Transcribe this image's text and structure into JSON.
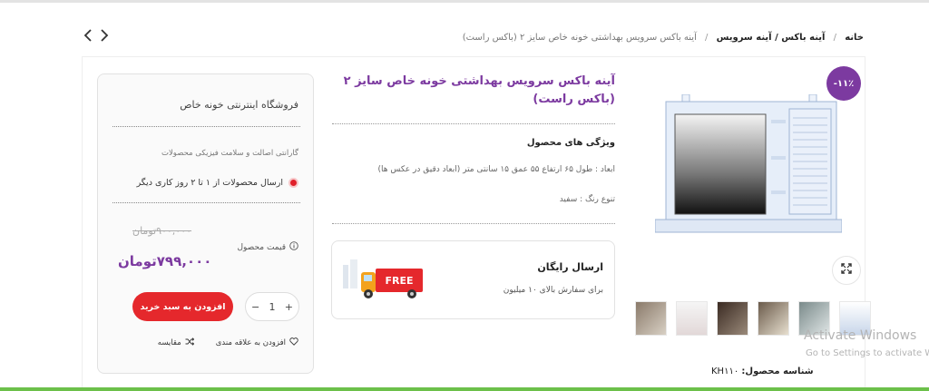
{
  "breadcrumb": {
    "home": "خانه",
    "category": "آینه باکس / آینه سرویس",
    "current": "آینه باکس سرویس بهداشتی خونه خاص سایز ۲ (باکس راست)",
    "separator": "/"
  },
  "nav": {
    "prev_icon": "chevron-left-icon",
    "next_icon": "chevron-right-icon"
  },
  "gallery": {
    "discount_badge": "-۱۱٪",
    "zoom_icon": "expand-icon",
    "thumbnail_count": 6,
    "sku_label": "شناسه محصول:",
    "sku_value": "KH۱۱۰"
  },
  "product": {
    "title": "آینه باکس سرویس بهداشتی خونه خاص سایز ۲ (باکس راست)",
    "features_heading": "ویژگی های محصول",
    "dimensions": "ابعاد : طول ۶۵ ارتفاع ۵۵ عمق ۱۵ سانتی متر (ابعاد دقیق در عکس ها)",
    "color_variety": "تنوع رنگ : سفید"
  },
  "shipping": {
    "title": "ارسال رایگان",
    "subtitle": "برای سفارش بالای ۱۰ میلیون",
    "truck_label": "FREE"
  },
  "buybox": {
    "shop_name": "فروشگاه اینترنتی خونه خاص",
    "guarantee": "گارانتی اصالت و سلامت فیزیکی محصولات",
    "delivery": "ارسال محصولات از ۱ تا ۲ روز کاری دیگر",
    "old_price": "۹۰۰,۰۰۰تومان",
    "price_label": "قیمت محصول",
    "price": "۷۹۹,۰۰۰تومان",
    "quantity": "1",
    "minus": "−",
    "plus": "+",
    "add_to_cart": "افزودن به سبد خرید",
    "wishlist": "افزودن به علاقه مندی",
    "compare": "مقایسه"
  },
  "watermark": {
    "title": "Activate Windows",
    "subtitle": "Go to Settings to activate Windows."
  },
  "colors": {
    "accent": "#7c3aa0",
    "cart_button": "#e5282c",
    "delivery_dot": "#e0202a"
  }
}
